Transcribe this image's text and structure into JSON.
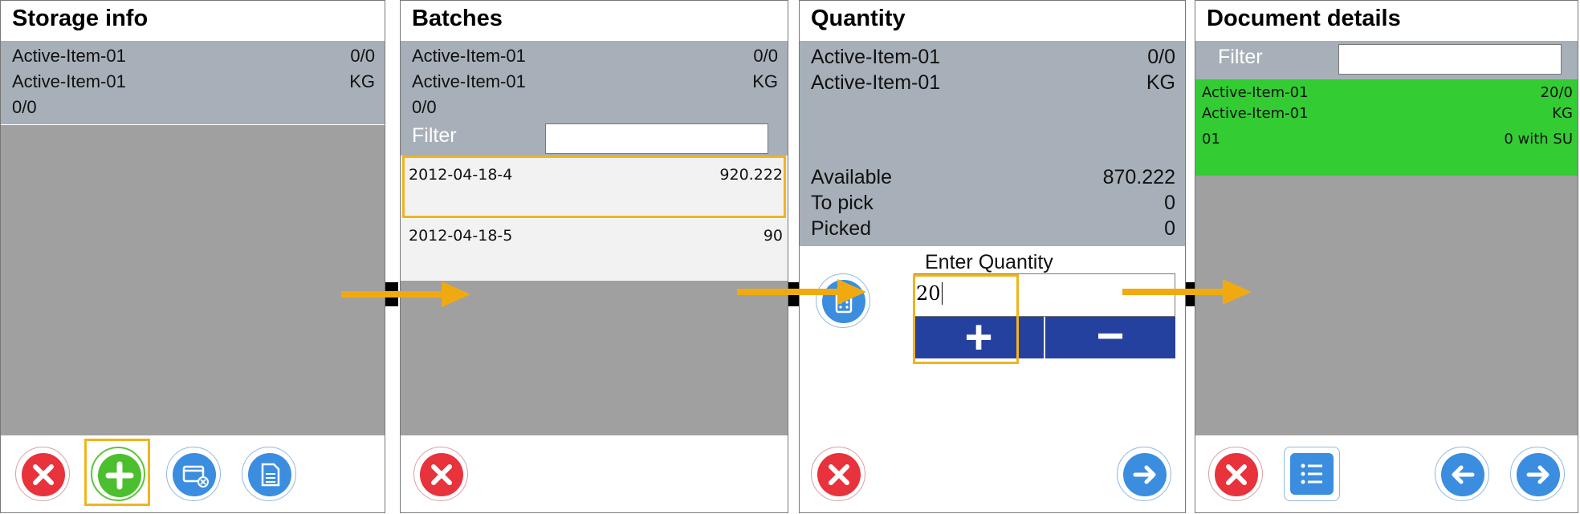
{
  "panels": {
    "storage": {
      "title": "Storage info",
      "line1_left": "Active-Item-01",
      "line1_right": "0/0",
      "line2_left": "Active-Item-01",
      "line2_right": "KG",
      "line3_left": "0/0"
    },
    "batches": {
      "title": "Batches",
      "line1_left": "Active-Item-01",
      "line1_right": "0/0",
      "line2_left": "Active-Item-01",
      "line2_right": "KG",
      "line3_left": "0/0",
      "filter_label": "Filter",
      "filter_value": "",
      "items": [
        {
          "batch": "2012-04-18-4",
          "qty": "920.222"
        },
        {
          "batch": "2012-04-18-5",
          "qty": "90"
        }
      ]
    },
    "quantity": {
      "title": "Quantity",
      "line1_left": "Active-Item-01",
      "line1_right": "0/0",
      "line2_left": "Active-Item-01",
      "line2_right": "KG",
      "available_label": "Available",
      "available_value": "870.222",
      "topick_label": "To pick",
      "topick_value": "0",
      "picked_label": "Picked",
      "picked_value": "0",
      "enter_label": "Enter Quantity",
      "qty_value": "20",
      "plus_label": "+",
      "minus_label": "−"
    },
    "document": {
      "title": "Document details",
      "filter_label": "Filter",
      "filter_value": "",
      "item_line1_left": "Active-Item-01",
      "item_line1_right": "20/0",
      "item_line2_left": "Active-Item-01",
      "item_line2_right": "KG",
      "item_line3_left": "01",
      "item_line3_right": "0 with SU"
    }
  },
  "colors": {
    "accent_highlight": "#f0b420",
    "arrow": "#f0aa10",
    "info_bg": "#a7b0b9",
    "empty_bg": "#a0a0a0",
    "selected_green": "#33cc33",
    "stepper_blue": "#2541a0",
    "cancel_red": "#e8323c",
    "action_blue": "#3b8de0"
  },
  "icons": [
    "cancel-icon",
    "add-icon",
    "remove-storage-icon",
    "document-icon",
    "calculator-icon",
    "arrow-right-icon",
    "arrow-left-icon",
    "list-icon"
  ]
}
